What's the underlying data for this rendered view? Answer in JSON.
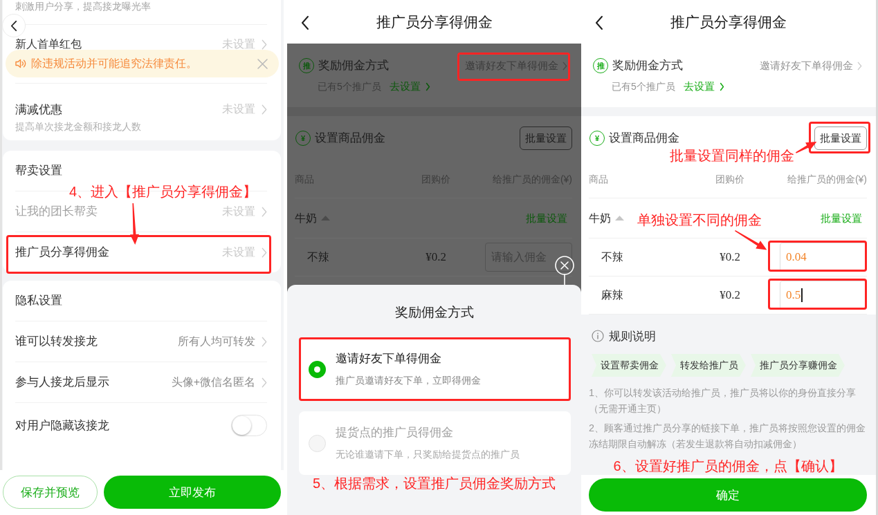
{
  "settings_screen": {
    "hint": "刺激用户分享，提高接龙曝光率",
    "peek_row": {
      "label": "新人首单红包",
      "value": "未设置",
      "configured": false
    },
    "notice": "除违规活动并可能追究法律责任。",
    "sections": [
      {
        "rows": [
          {
            "kind": "link",
            "label": "满减优惠",
            "subtitle": "提高单次接龙金额和接龙人数",
            "value": "未设置",
            "configured": false,
            "disabled": false,
            "highlighted": false
          }
        ]
      },
      {
        "title": "帮卖设置",
        "rows": [
          {
            "kind": "link",
            "label": "让我的团长帮卖",
            "value": "未设置",
            "configured": false,
            "disabled": true,
            "highlighted": false
          },
          {
            "kind": "link",
            "label": "推广员分享得佣金",
            "value": "未设置",
            "configured": false,
            "disabled": false,
            "highlighted": true
          }
        ]
      },
      {
        "title": "隐私设置",
        "rows": [
          {
            "kind": "link",
            "label": "谁可以转发接龙",
            "value": "所有人均可转发",
            "configured": true,
            "disabled": false,
            "highlighted": false
          },
          {
            "kind": "link",
            "label": "参与人接龙后显示",
            "value": "头像+微信名匿名",
            "configured": true,
            "disabled": false,
            "highlighted": false
          },
          {
            "kind": "toggle",
            "label": "对用户隐藏该接龙",
            "on": false,
            "disabled": false,
            "highlighted": false
          }
        ]
      }
    ],
    "step_note": "4、进入【推广员分享得佣金】",
    "buttons": [
      {
        "kind": "outline",
        "label": "保存并预览"
      },
      {
        "kind": "primary",
        "label": "立即发布"
      }
    ]
  },
  "method_screen": {
    "title": "推广员分享得佣金",
    "dimmed": true,
    "reward": {
      "badge": "推",
      "label": "奖励佣金方式",
      "value": "邀请好友下单得佣金",
      "value_highlighted": true,
      "note": "已有5个推广员",
      "link": "去设置"
    },
    "commission": {
      "badge": "¥",
      "label": "设置商品佣金",
      "batch_button": "批量设置",
      "batch_highlighted": false,
      "columns": [
        "商品",
        "团购价",
        "给推广员的佣金(¥)"
      ],
      "group": {
        "name": "牛奶",
        "expanded": true,
        "batch_link": "批量设置"
      },
      "rows": [
        {
          "name": "不辣",
          "price": "¥0.2",
          "placeholder": "请输入佣金",
          "focused": false,
          "highlighted": false
        }
      ]
    },
    "sheet": {
      "title": "奖励佣金方式",
      "options": [
        {
          "title": "邀请好友下单得佣金",
          "description": "推广员邀请好友下单，立即得佣金",
          "selected": true,
          "disabled": false,
          "highlighted": true
        },
        {
          "title": "提货点的推广员得佣金",
          "description": "无论谁邀请下单，只奖励给提货点的推广员",
          "selected": false,
          "disabled": true,
          "highlighted": false
        }
      ]
    },
    "step_note": "5、根据需求，设置推广员佣金奖励方式"
  },
  "commission_screen": {
    "title": "推广员分享得佣金",
    "dimmed": false,
    "reward": {
      "badge": "推",
      "label": "奖励佣金方式",
      "value": "邀请好友下单得佣金",
      "value_highlighted": false,
      "note": "已有5个推广员",
      "link": "去设置"
    },
    "commission": {
      "badge": "¥",
      "label": "设置商品佣金",
      "batch_button": "批量设置",
      "batch_highlighted": true,
      "columns": [
        "商品",
        "团购价",
        "给推广员的佣金(¥)"
      ],
      "group": {
        "name": "牛奶",
        "expanded": true,
        "batch_link": "批量设置"
      },
      "rows": [
        {
          "name": "不辣",
          "price": "¥0.2",
          "value": "0.04",
          "focused": false,
          "highlighted": true
        },
        {
          "name": "麻辣",
          "price": "¥0.2",
          "value": "0.5",
          "focused": true,
          "highlighted": true
        }
      ]
    },
    "annotations": [
      "批量设置同样的佣金",
      "单独设置不同的佣金"
    ],
    "rules": {
      "title": "规则说明",
      "steps": [
        "设置帮卖佣金",
        "转发给推广员",
        "推广员分享赚佣金"
      ],
      "paragraphs": [
        "1、你可以转发该活动给推广员，推广员将以你的身份直接分享（无需开通主页）",
        "2、顾客通过推广员分享的链接下单，推广员将按照您设置的佣金冻结期限自动解冻（若发生退款将自动扣减佣金）"
      ]
    },
    "step_note": "6、设置好推广员的佣金，点【确认】",
    "confirm_button": "确定"
  }
}
